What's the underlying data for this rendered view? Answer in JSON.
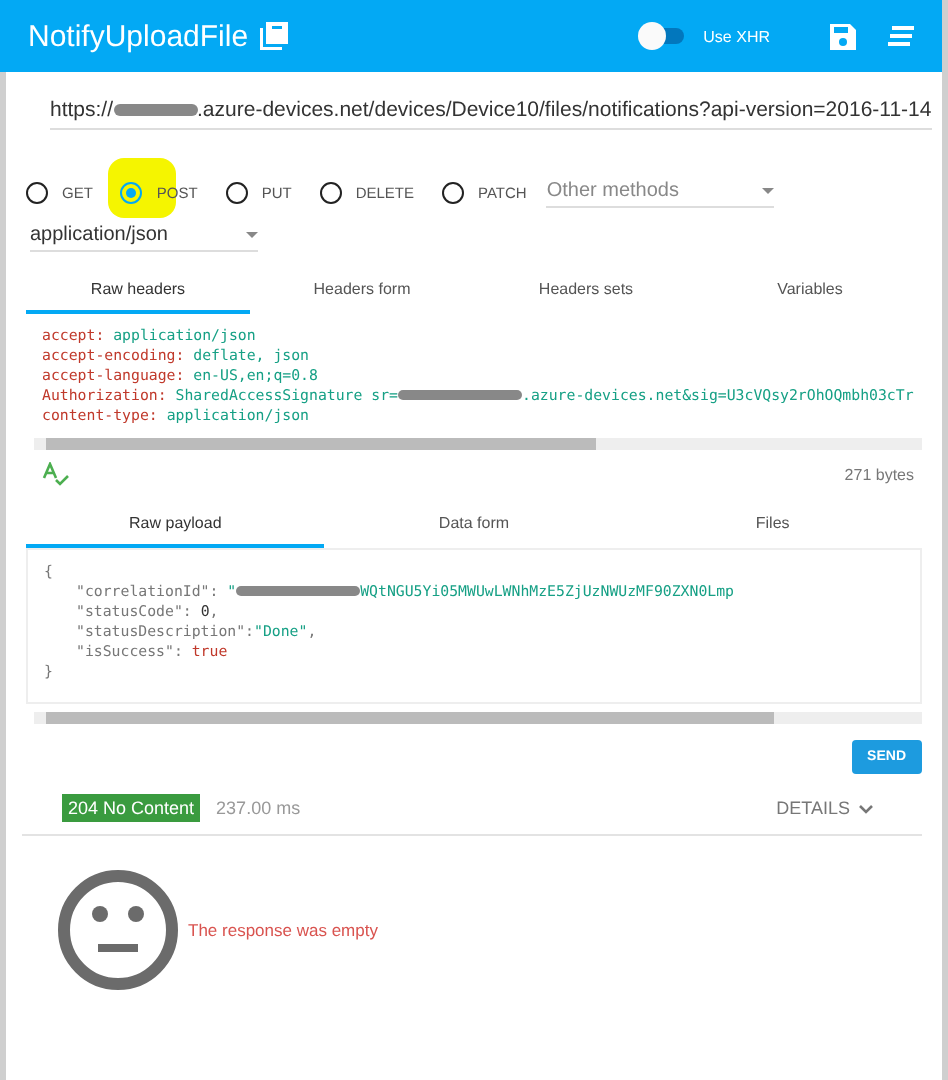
{
  "app_bar": {
    "title": "NotifyUploadFile",
    "xhr_toggle": {
      "label": "Use XHR",
      "on": false
    }
  },
  "url": {
    "start": "https://",
    "rest": ".azure-devices.net/devices/Device10/files/notifications?api-version=2016-11-14"
  },
  "methods": [
    {
      "label": "GET",
      "selected": false
    },
    {
      "label": "POST",
      "selected": true,
      "highlighted": true
    },
    {
      "label": "PUT",
      "selected": false
    },
    {
      "label": "DELETE",
      "selected": false
    },
    {
      "label": "PATCH",
      "selected": false
    }
  ],
  "other_methods": {
    "placeholder": "Other methods"
  },
  "content_type": "application/json",
  "header_tabs": [
    {
      "label": "Raw headers",
      "selected": true
    },
    {
      "label": "Headers form",
      "selected": false
    },
    {
      "label": "Headers sets",
      "selected": false
    },
    {
      "label": "Variables",
      "selected": false
    }
  ],
  "headers": [
    {
      "name": "accept:",
      "value": "application/json"
    },
    {
      "name": "accept-encoding:",
      "value": "deflate, json"
    },
    {
      "name": "accept-language:",
      "value": "en-US,en;q=0.8"
    },
    {
      "name": "Authorization:",
      "value": "SharedAccessSignature sr=",
      "redacted": true,
      "value_after": ".azure-devices.net&sig=U3cVQsy2rOhOQmbh03cTr"
    },
    {
      "name": "content-type:",
      "value": "application/json"
    }
  ],
  "payload_size": "271 bytes",
  "payload_tabs": [
    {
      "label": "Raw payload",
      "selected": true
    },
    {
      "label": "Data form",
      "selected": false
    },
    {
      "label": "Files",
      "selected": false
    }
  ],
  "payload_lines": [
    [
      {
        "kind": "punct",
        "text": "{"
      }
    ],
    [
      {
        "kind": "key",
        "text": "\"correlationId\""
      },
      {
        "kind": "punct",
        "text": ": "
      },
      {
        "kind": "string",
        "text": "\""
      },
      {
        "kind": "redacted"
      },
      {
        "kind": "string",
        "text": "WQtNGU5Yi05MWUwLWNhMzE5ZjUzNWUzMF90ZXN0Lmp"
      }
    ],
    [
      {
        "kind": "key",
        "text": "\"statusCode\""
      },
      {
        "kind": "punct",
        "text": ": "
      },
      {
        "kind": "number",
        "text": "0"
      },
      {
        "kind": "punct",
        "text": ","
      }
    ],
    [
      {
        "kind": "key",
        "text": "\"statusDescription\""
      },
      {
        "kind": "punct",
        "text": ":"
      },
      {
        "kind": "string",
        "text": "\"Done\""
      },
      {
        "kind": "punct",
        "text": ","
      }
    ],
    [
      {
        "kind": "key",
        "text": "\"isSuccess\""
      },
      {
        "kind": "punct",
        "text": ": "
      },
      {
        "kind": "bool",
        "text": "true"
      }
    ],
    [
      {
        "kind": "punct",
        "text": "}"
      }
    ]
  ],
  "send_button": "SEND",
  "response": {
    "status": "204 No Content",
    "time": "237.00 ms",
    "details": "DETAILS",
    "message": "The response was empty"
  }
}
